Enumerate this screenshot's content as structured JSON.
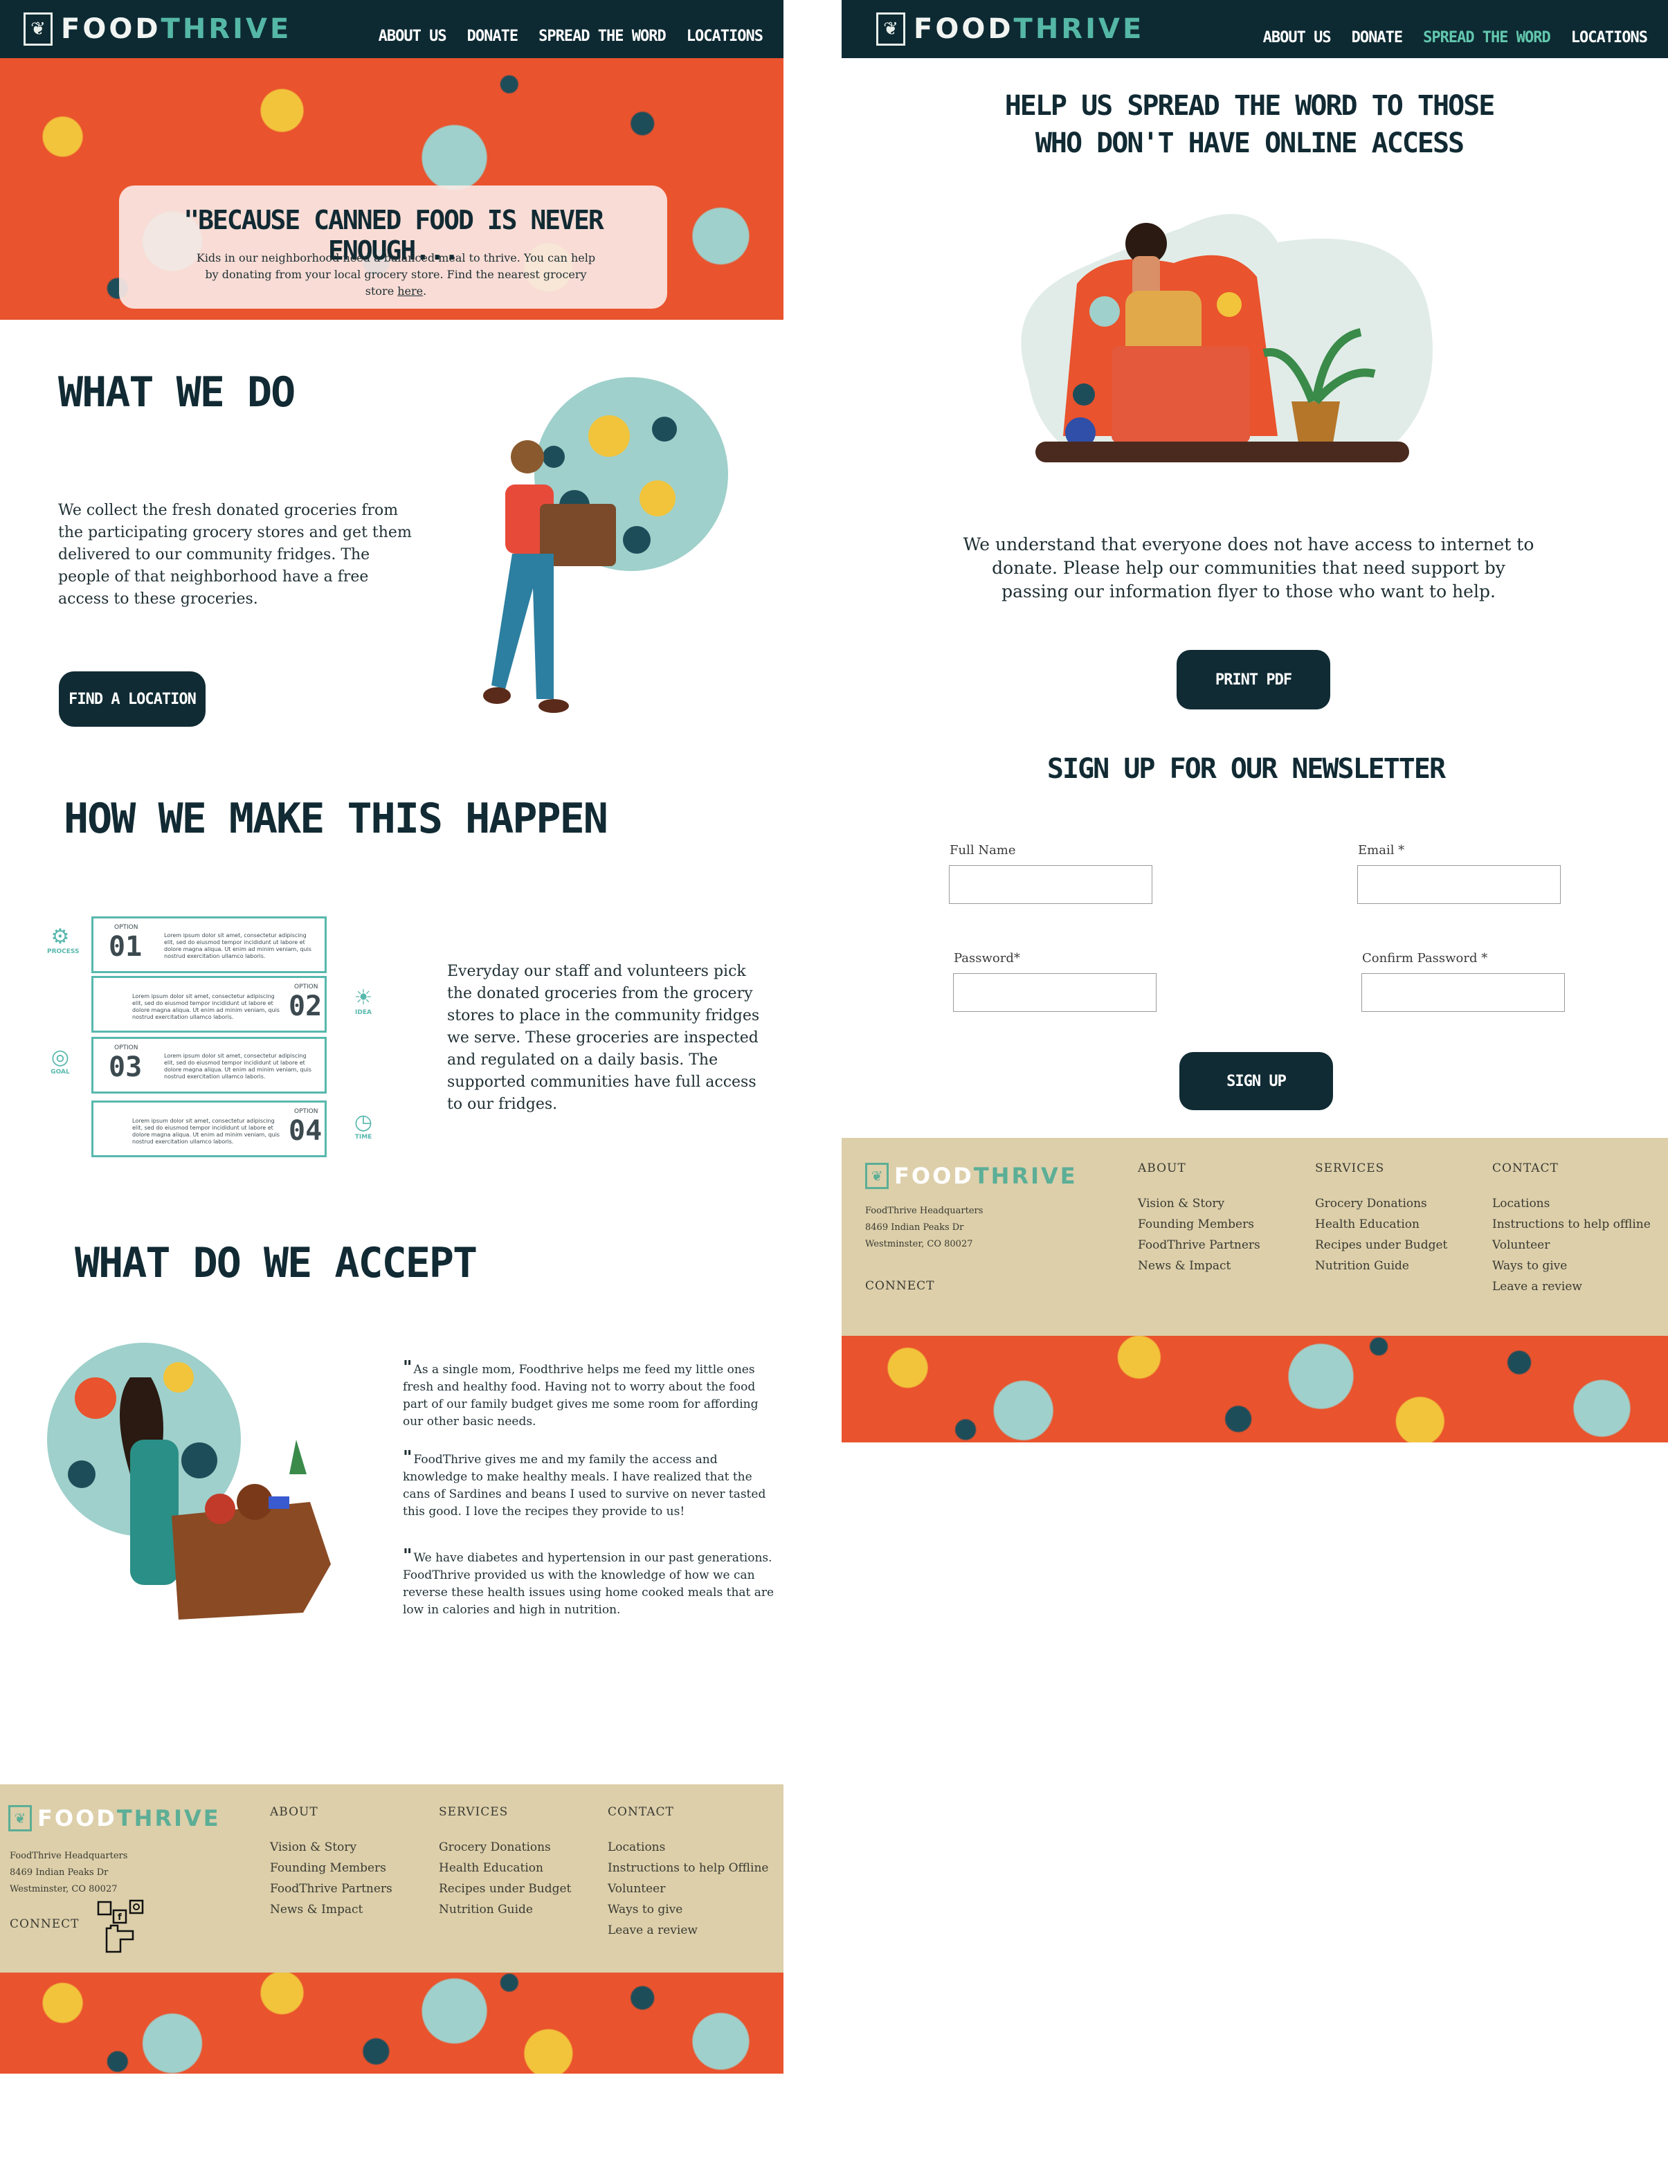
{
  "brand": {
    "word1": "FOOD",
    "word2": "THRIVE",
    "logo_icon": "leaf-icon"
  },
  "nav": {
    "about": "ABOUT US",
    "donate": "DONATE",
    "spread": "SPREAD THE WORD",
    "locations": "LOCATIONS"
  },
  "home": {
    "hero": {
      "title": "\"BECAUSE CANNED FOOD IS NEVER ENOUGH...",
      "sub_text": "Kids in our neighborhood need a balanced meal to thrive. You can help by donating from your local grocery store. Find the nearest grocery store ",
      "sub_link": "here",
      "sub_end": "."
    },
    "what_we_do": {
      "title": "WHAT WE DO",
      "body": "We collect the fresh donated groceries from the participating grocery stores and get them delivered to our community fridges. The people of that neighborhood have a free access to these groceries.",
      "button": "FIND A LOCATION"
    },
    "how": {
      "title": "HOW WE MAKE THIS HAPPEN",
      "options": [
        {
          "label": "OPTION",
          "num": "01",
          "icon": "gear-icon",
          "icon_label": "PROCESS",
          "text": "Lorem ipsum dolor sit amet, consectetur adipiscing elit, sed do eiusmod tempor incididunt ut labore et dolore magna aliqua. Ut enim ad minim veniam, quis nostrud exercitation ullamco laboris."
        },
        {
          "label": "OPTION",
          "num": "02",
          "icon": "lightbulb-icon",
          "icon_label": "IDEA",
          "text": "Lorem ipsum dolor sit amet, consectetur adipiscing elit, sed do eiusmod tempor incididunt ut labore et dolore magna aliqua. Ut enim ad minim veniam, quis nostrud exercitation ullamco laboris."
        },
        {
          "label": "OPTION",
          "num": "03",
          "icon": "target-icon",
          "icon_label": "GOAL",
          "text": "Lorem ipsum dolor sit amet, consectetur adipiscing elit, sed do eiusmod tempor incididunt ut labore et dolore magna aliqua. Ut enim ad minim veniam, quis nostrud exercitation ullamco laboris."
        },
        {
          "label": "OPTION",
          "num": "04",
          "icon": "clock-icon",
          "icon_label": "TIME",
          "text": "Lorem ipsum dolor sit amet, consectetur adipiscing elit, sed do eiusmod tempor incididunt ut labore et dolore magna aliqua. Ut enim ad minim veniam, quis nostrud exercitation ullamco laboris."
        }
      ],
      "body": "Everyday our staff and volunteers pick the donated groceries from the grocery stores to place in the community fridges we serve. These groceries are inspected and regulated on a daily basis. The supported communities have full access to our fridges."
    },
    "accept": {
      "title": "WHAT DO WE ACCEPT",
      "quote_mark": "\"",
      "quotes": [
        "As a single mom, Foodthrive helps me feed my little ones fresh and healthy food. Having not to worry about the food part of our family budget gives me some room for affording our other basic needs.",
        "FoodThrive gives me and my family the access and knowledge to make healthy meals. I have realized that the cans of Sardines and beans I used to survive on never tasted this good. I love the recipes they provide to us!",
        "We have diabetes and hypertension in our past generations. FoodThrive provided us with the knowledge of how we can reverse these health issues using home cooked meals that are low in calories and high in nutrition."
      ]
    }
  },
  "spread": {
    "title_line1": "HELP US SPREAD THE WORD TO THOSE",
    "title_line2": "WHO DON'T HAVE ONLINE ACCESS",
    "body": "We understand that everyone does not have access to internet to donate. Please help our communities that need support by passing our information flyer to those who want to help.",
    "print_button": "PRINT PDF",
    "newsletter_title": "SIGN UP FOR OUR NEWSLETTER",
    "form": {
      "full_name": "Full Name",
      "email": "Email *",
      "password": "Password*",
      "confirm": "Confirm Password *",
      "submit": "SIGN UP"
    }
  },
  "footer_a": {
    "address": [
      "FoodThrive Headquarters",
      "8469 Indian Peaks Dr",
      "Westminster, CO 80027"
    ],
    "connect": "CONNECT",
    "about": {
      "heading": "ABOUT",
      "items": [
        "Vision & Story",
        "Founding Members",
        "FoodThrive Partners",
        "News & Impact"
      ]
    },
    "services": {
      "heading": "SERVICES",
      "items": [
        "Grocery Donations",
        "Health Education",
        "Recipes under Budget",
        "Nutrition Guide"
      ]
    },
    "contact": {
      "heading": "CONTACT",
      "items": [
        "Locations",
        "Instructions to help Offline",
        "Volunteer",
        "Ways to give",
        "Leave a review"
      ]
    }
  },
  "footer_b": {
    "address": [
      "FoodThrive Headquarters",
      "8469 Indian Peaks Dr",
      "Westminster, CO 80027"
    ],
    "connect": "CONNECT",
    "about": {
      "heading": "ABOUT",
      "items": [
        "Vision & Story",
        "Founding Members",
        "FoodThrive Partners",
        "News & Impact"
      ]
    },
    "services": {
      "heading": "SERVICES",
      "items": [
        "Grocery Donations",
        "Health Education",
        "Recipes under Budget",
        "Nutrition Guide"
      ]
    },
    "contact": {
      "heading": "CONTACT",
      "items": [
        "Locations",
        "Instructions to help offline",
        "Volunteer",
        "Ways to give",
        "Leave a review"
      ]
    }
  },
  "colors": {
    "navy": "#0d2a33",
    "teal": "#55b7a6",
    "orange": "#e9532d",
    "yellow": "#f2c43c",
    "beige": "#dccfaa"
  }
}
